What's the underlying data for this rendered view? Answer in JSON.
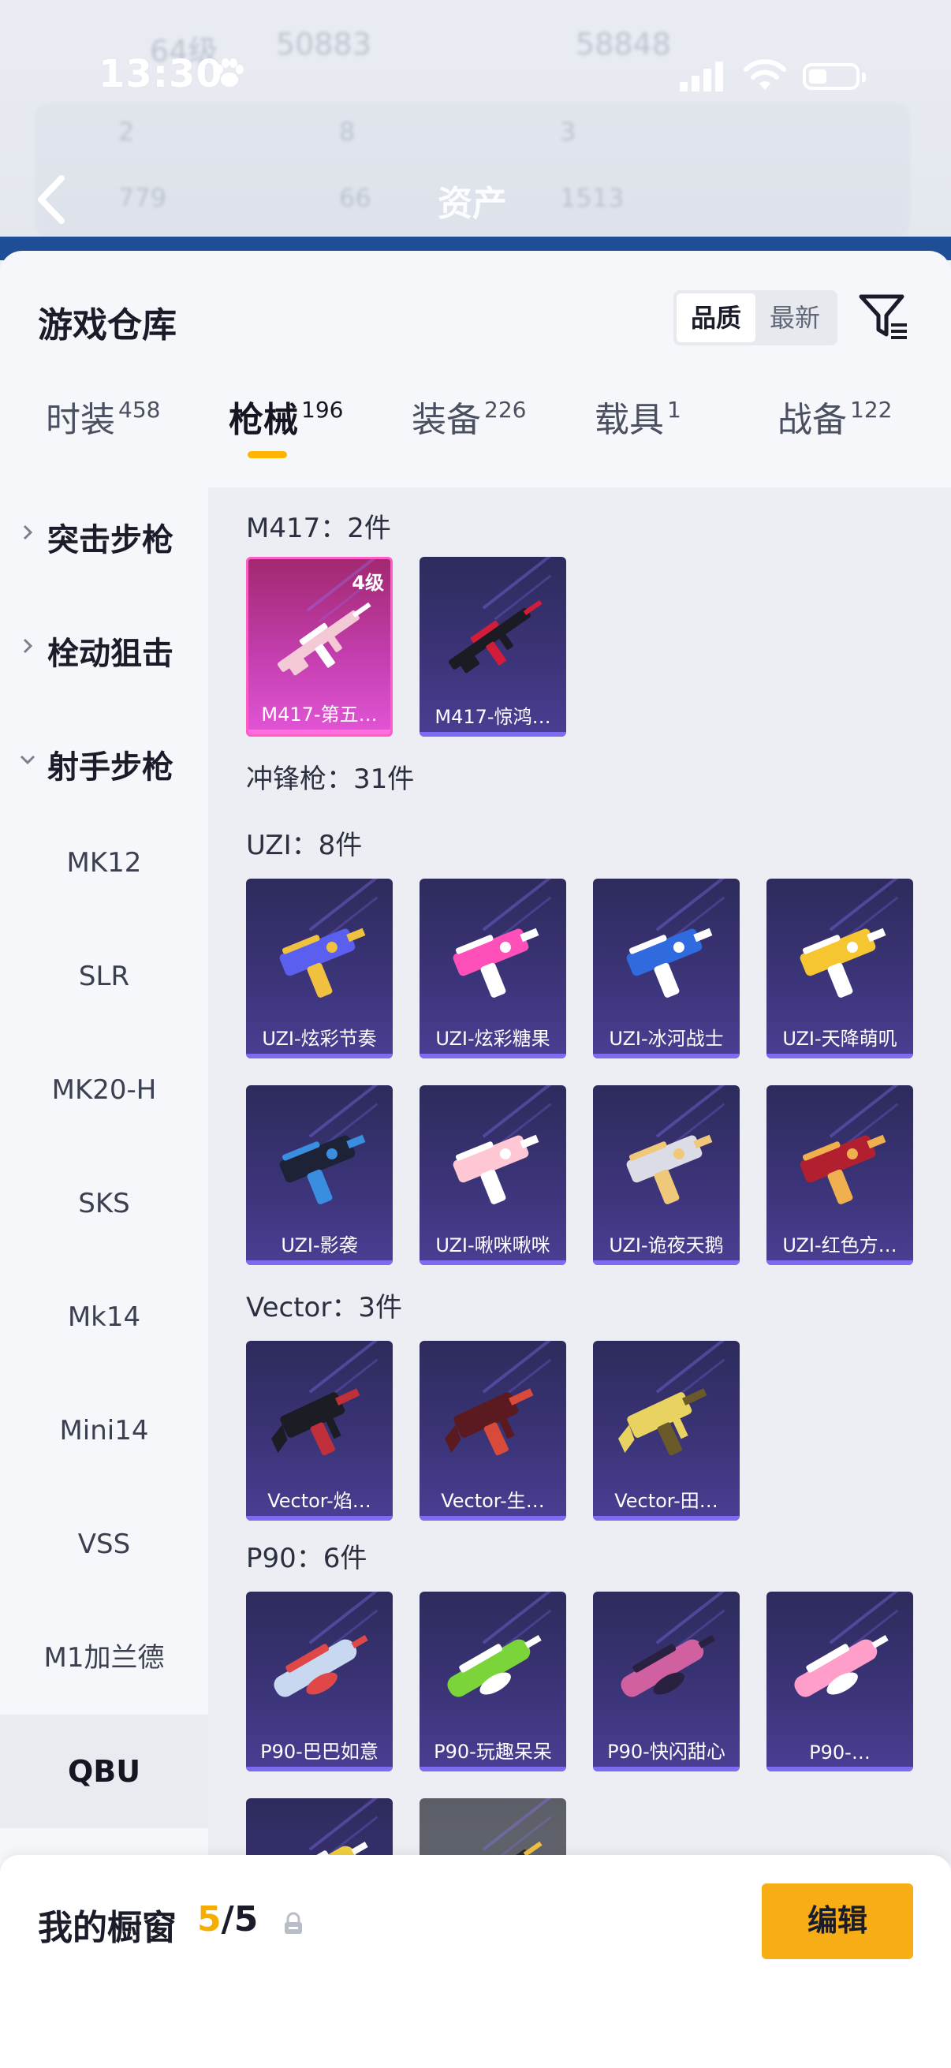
{
  "status_bar": {
    "time": "13:30"
  },
  "background": {
    "title": "资产",
    "stats": [
      "64级",
      "50883",
      "58848",
      "2",
      "8",
      "3",
      "779",
      "66",
      "1513"
    ]
  },
  "sheet": {
    "title": "游戏仓库",
    "sort": {
      "options": [
        "品质",
        "最新"
      ],
      "selected": "品质"
    },
    "filter_icon": "filter-icon"
  },
  "category_tabs": [
    {
      "label": "时装",
      "count": "458"
    },
    {
      "label": "枪械",
      "count": "196",
      "active": true
    },
    {
      "label": "装备",
      "count": "226"
    },
    {
      "label": "载具",
      "count": "1"
    },
    {
      "label": "战备",
      "count": "122"
    }
  ],
  "side_menu": {
    "groups": [
      {
        "label": "突击步枪",
        "expanded": false
      },
      {
        "label": "栓动狙击",
        "expanded": false
      },
      {
        "label": "射手步枪",
        "expanded": true
      }
    ],
    "items": [
      "MK12",
      "SLR",
      "MK20-H",
      "SKS",
      "Mk14",
      "Mini14",
      "VSS",
      "M1加兰德",
      "QBU"
    ],
    "active_item": "QBU"
  },
  "content": {
    "sections": [
      {
        "title": "M417：2件"
      },
      {
        "title": "冲锋枪：31件"
      },
      {
        "title": "UZI：8件"
      },
      {
        "title": "Vector：3件"
      },
      {
        "title": "P90：6件"
      }
    ],
    "m417": [
      {
        "name": "M417-第五…",
        "level": "4级",
        "colors": [
          "#f4c9d6",
          "#ffffff"
        ]
      },
      {
        "name": "M417-惊鸿…",
        "colors": [
          "#1b1b24",
          "#d21d3a"
        ]
      }
    ],
    "uzi": [
      {
        "name": "UZI-炫彩节奏",
        "colors": [
          "#5a5ff0",
          "#f0c040"
        ]
      },
      {
        "name": "UZI-炫彩糖果",
        "colors": [
          "#ff4fb8",
          "#ffffff"
        ]
      },
      {
        "name": "UZI-冰河战士",
        "colors": [
          "#2f6bdf",
          "#ffffff"
        ]
      },
      {
        "name": "UZI-天降萌叽",
        "colors": [
          "#f5c630",
          "#ffffff"
        ]
      },
      {
        "name": "UZI-影袭",
        "colors": [
          "#1d2236",
          "#3a8ee0"
        ]
      },
      {
        "name": "UZI-啾咪啾咪",
        "colors": [
          "#ffc6d3",
          "#ffffff"
        ]
      },
      {
        "name": "UZI-诡夜天鹅",
        "colors": [
          "#dcdce6",
          "#f0c87a"
        ]
      },
      {
        "name": "UZI-红色方…",
        "colors": [
          "#b22030",
          "#f0b050"
        ]
      }
    ],
    "vector": [
      {
        "name": "Vector-焰…",
        "colors": [
          "#1c1c24",
          "#c0303a"
        ]
      },
      {
        "name": "Vector-生…",
        "colors": [
          "#5a1a20",
          "#d84a3a"
        ]
      },
      {
        "name": "Vector-田…",
        "colors": [
          "#e8d260",
          "#6a5a2a"
        ]
      }
    ],
    "p90": [
      {
        "name": "P90-巴巴如意",
        "colors": [
          "#c8d8f0",
          "#e04848"
        ]
      },
      {
        "name": "P90-玩趣呆呆",
        "colors": [
          "#7ad43a",
          "#ffffff"
        ]
      },
      {
        "name": "P90-快闪甜心",
        "colors": [
          "#d060a0",
          "#2a2040"
        ]
      },
      {
        "name": "P90-…",
        "colors": [
          "#ff9ec8",
          "#ffffff"
        ]
      }
    ],
    "partial": [
      {
        "name": "",
        "colors": [
          "#f0d040",
          "#ffffff"
        ]
      },
      {
        "name": "",
        "colors": [
          "#2a2a30",
          "#f0c040"
        ],
        "gray": true
      }
    ]
  },
  "fab": {
    "icon": "share-icon"
  },
  "showcase": {
    "label": "我的橱窗",
    "current": "5",
    "separator": "/",
    "total": "5",
    "edit_label": "编辑"
  }
}
